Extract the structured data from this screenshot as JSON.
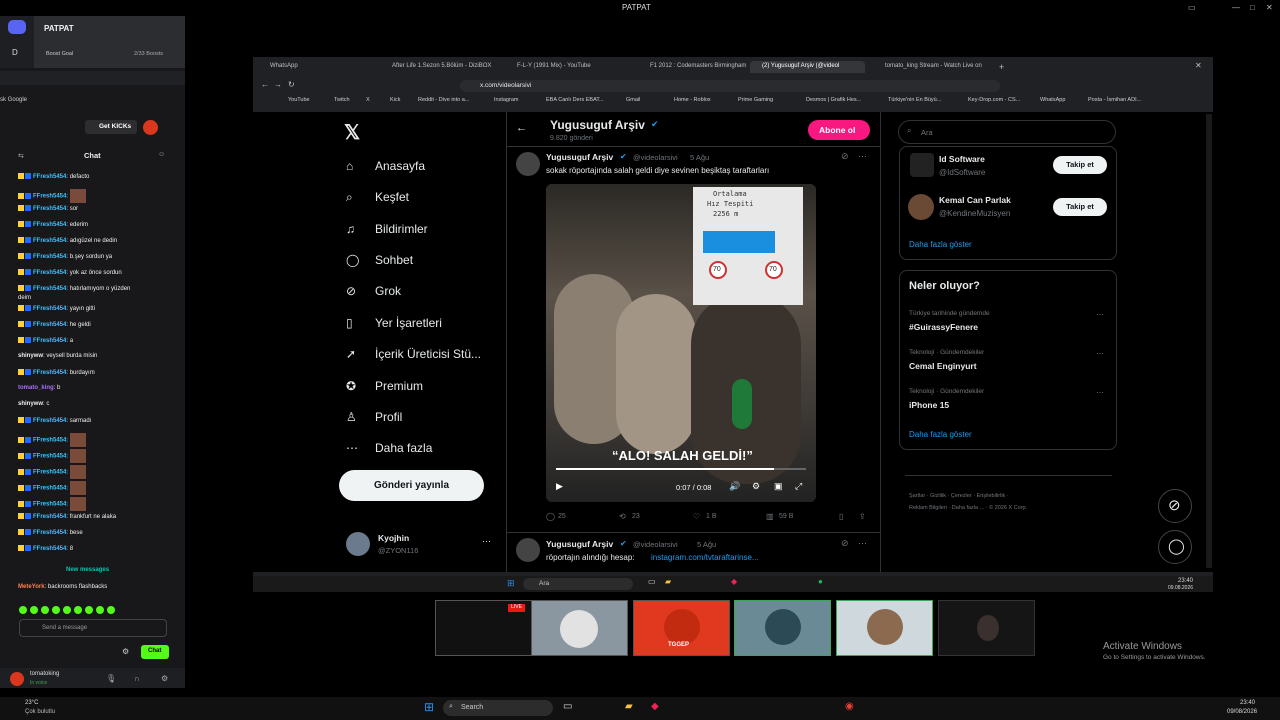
{
  "window": {
    "title": "PATPAT"
  },
  "discord": {
    "server_letter": "D",
    "server_name": "PATPAT",
    "boost_goal": "Boost Goal",
    "boosts": "2/33 Boosts",
    "search_text": "sk Google",
    "get_kicks": "Get KICKs",
    "chat_title": "Chat",
    "chat_messages": [
      {
        "user": "FFresh5454",
        "text": "defacto",
        "emote": false
      },
      {
        "user": "FFresh5454",
        "text": "",
        "emote": true
      },
      {
        "user": "FFresh5454",
        "text": "sor",
        "emote": false
      },
      {
        "user": "FFresh5454",
        "text": "ederim",
        "emote": false
      },
      {
        "user": "FFresh5454",
        "text": "adıgüzel ne dedin",
        "emote": false
      },
      {
        "user": "FFresh5454",
        "text": "b.şey sordun ya",
        "emote": false
      },
      {
        "user": "FFresh5454",
        "text": "yok az önce sordun",
        "emote": false
      },
      {
        "user": "FFresh5454",
        "text": "hatırlamıyom o yüzden",
        "emote": false
      },
      {
        "user": "",
        "text": "deim",
        "emote": false
      },
      {
        "user": "FFresh5454",
        "text": "yayın gitti",
        "emote": false
      },
      {
        "user": "FFresh5454",
        "text": "he geldi",
        "emote": false
      },
      {
        "user": "FFresh5454",
        "text": "a",
        "emote": false
      },
      {
        "user": "shinyww",
        "text": "veysell burda misin",
        "emote": false
      },
      {
        "user": "FFresh5454",
        "text": "burdayım",
        "emote": false
      },
      {
        "user": "tomato_king",
        "text": "b",
        "emote": false
      },
      {
        "user": "shinyww",
        "text": "c",
        "emote": false
      },
      {
        "user": "FFresh5454",
        "text": "sarmadı",
        "emote": false
      },
      {
        "user": "FFresh5454",
        "text": "",
        "emote": true
      },
      {
        "user": "FFresh5454",
        "text": "",
        "emote": true
      },
      {
        "user": "FFresh5454",
        "text": "",
        "emote": true
      },
      {
        "user": "FFresh5454",
        "text": "",
        "emote": true
      },
      {
        "user": "FFresh5454",
        "text": "",
        "emote": true
      },
      {
        "user": "FFresh5454",
        "text": "frankfurt ne alaka",
        "emote": false
      },
      {
        "user": "FFresh5454",
        "text": "bese",
        "emote": false
      },
      {
        "user": "FFresh5454",
        "text": "8",
        "emote": false
      }
    ],
    "new_messages": "New messages",
    "last_message": {
      "user": "MeteYork",
      "text": "backrooms flashbacks"
    },
    "send_placeholder": "Send a message",
    "chat_button": "Chat",
    "user_name": "tomatoking",
    "user_status": "In voice"
  },
  "browser": {
    "tabs": [
      {
        "label": "WhatsApp"
      },
      {
        "label": "After Life 1.Sezon 5.Bölüm - DiziBOX"
      },
      {
        "label": "F-L-Y (1991 Mix) - YouTube"
      },
      {
        "label": "F1 2012 : Codemasters Birmingham"
      },
      {
        "label": "(2) Yugusuguf Arşiv (@videol"
      },
      {
        "label": "tomato_king Stream - Watch Live on"
      }
    ],
    "url": "x.com/videolarsivi",
    "bookmarks": [
      "YouTube",
      "Twitch",
      "X",
      "Kick",
      "Reddit - Dive into a...",
      "Instagram",
      "EBA Canlı Ders EBAT...",
      "Gmail",
      "Home - Roblox",
      "Prime Gaming",
      "Desmos | Grafik Hes...",
      "Türkiye'nin En Büyü...",
      "Key-Drop.com - CS...",
      "WhatsApp",
      "Posta - İsmihan ADI..."
    ]
  },
  "x": {
    "nav": [
      {
        "label": "Anasayfa",
        "icon": "⌂",
        "name": "home"
      },
      {
        "label": "Keşfet",
        "icon": "⌕",
        "name": "explore"
      },
      {
        "label": "Bildirimler",
        "icon": "♫",
        "name": "notifications"
      },
      {
        "label": "Sohbet",
        "icon": "◯",
        "name": "chat"
      },
      {
        "label": "Grok",
        "icon": "⊘",
        "name": "grok"
      },
      {
        "label": "Yer İşaretleri",
        "icon": "▯",
        "name": "bookmarks"
      },
      {
        "label": "İçerik Üreticisi Stü...",
        "icon": "➚",
        "name": "creator-studio"
      },
      {
        "label": "Premium",
        "icon": "✪",
        "name": "premium"
      },
      {
        "label": "Profil",
        "icon": "♙",
        "name": "profile"
      },
      {
        "label": "Daha fazla",
        "icon": "⋯",
        "name": "more"
      }
    ],
    "post_button": "Gönderi yayınla",
    "account": {
      "name": "Kyojhin",
      "handle": "@ZYON116"
    },
    "profile": {
      "name": "Yugusuguf Arşiv",
      "posts": "9.820 gönderi",
      "subscribe": "Abone ol"
    },
    "post1": {
      "name": "Yugusuguf Arşiv",
      "handle": "@videolarsivi",
      "time": "5 Ağu",
      "text": "sokak röportajında salah geldi diye sevinen beşiktaş taraftarları",
      "caption": "“ALO! SALAH GELDİ!”",
      "sign_lines": [
        "Ortalama",
        "Hız Tespiti",
        "2256 m"
      ],
      "speed1": "70",
      "speed2": "70",
      "video_time": "0:07 / 0:08",
      "replies": "25",
      "reposts": "23",
      "likes": "1 B",
      "views": "59 B",
      "progress": 0.87
    },
    "post2": {
      "name": "Yugusuguf Arşiv",
      "handle": "@videolarsivi",
      "time": "5 Ağu",
      "text": "röportajın alındığı hesap:",
      "link": "instagram.com/tvtaraftarinse..."
    },
    "search_placeholder": "Ara",
    "who_to_follow": [
      {
        "name": "Id Software",
        "handle": "@IdSoftware",
        "button": "Takip et"
      },
      {
        "name": "Kemal Can Parlak",
        "handle": "@KendineMuzisyen",
        "button": "Takip et"
      }
    ],
    "show_more": "Daha fazla göster",
    "trending_title": "Neler oluyor?",
    "trends": [
      {
        "context": "Türkiye tarihinde gündemde",
        "topic": "#GuirassyFenere"
      },
      {
        "context": "Teknoloji · Gündemdekiler",
        "topic": "Cemal Enginyurt"
      },
      {
        "context": "Teknoloji · Gündemdekiler",
        "topic": "iPhone 15"
      }
    ],
    "footer": [
      "Şartlar",
      "Gizlilik",
      "Çerezler",
      "Erişilebilirlik",
      "Reklam Bilgileri",
      "Daha fazla ...",
      "© 2026 X Corp."
    ]
  },
  "taskbar": {
    "search": "Ara",
    "time": "23:40",
    "date": "09.08.2026",
    "search2": "Search",
    "weather_temp": "23°C",
    "weather_text": "Çok bulutlu",
    "time2": "23:40",
    "date2": "09/08/2026"
  },
  "activate": {
    "title": "Activate Windows",
    "sub": "Go to Settings to activate Windows."
  },
  "live_badge": "LIVE",
  "tomato_label": "TGGEP"
}
